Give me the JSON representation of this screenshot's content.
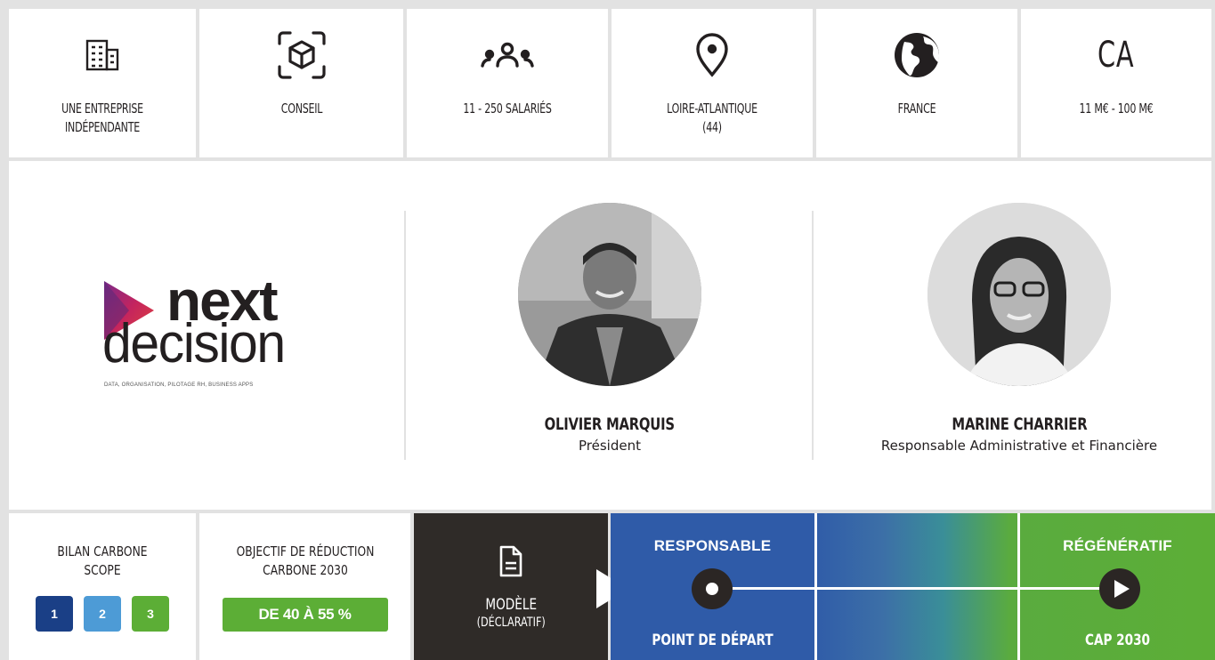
{
  "info": {
    "company_type": "UNE ENTREPRISE\nINDÉPENDANTE",
    "sector": "CONSEIL",
    "employees": "11 - 250 SALARIÉS",
    "location": "LOIRE-ATLANTIQUE\n(44)",
    "country": "FRANCE",
    "revenue_icon_text": "CA",
    "revenue": "11 M€ - 100 M€"
  },
  "company": {
    "logo_word_1": "next",
    "logo_word_2": "decision",
    "logo_tagline": "DATA, ORGANISATION, PILOTAGE RH, BUSINESS APPS",
    "accent": "#c4245e"
  },
  "people": [
    {
      "name": "OLIVIER MARQUIS",
      "role": "Président"
    },
    {
      "name": "MARINE CHARRIER",
      "role": "Responsable Administrative et Financière"
    }
  ],
  "carbon": {
    "title": "BILAN CARBONE\nSCOPE",
    "scopes": [
      {
        "label": "1",
        "color": "#1a3f86"
      },
      {
        "label": "2",
        "color": "#4d9bd6"
      },
      {
        "label": "3",
        "color": "#5cae36"
      }
    ],
    "objective_title": "OBJECTIF DE RÉDUCTION\nCARBONE  2030",
    "objective_value": "DE 40 À 55 %"
  },
  "model": {
    "label": "MODÈLE",
    "sublabel": "(DÉCLARATIF)",
    "icon": "document-icon"
  },
  "scale": {
    "start_label": "RESPONSABLE",
    "start_caption": "POINT DE DÉPART",
    "end_label": "RÉGÉNÉRATIF",
    "end_caption": "CAP 2030",
    "start_color": "#2f5ba8",
    "end_color": "#5cae36"
  }
}
